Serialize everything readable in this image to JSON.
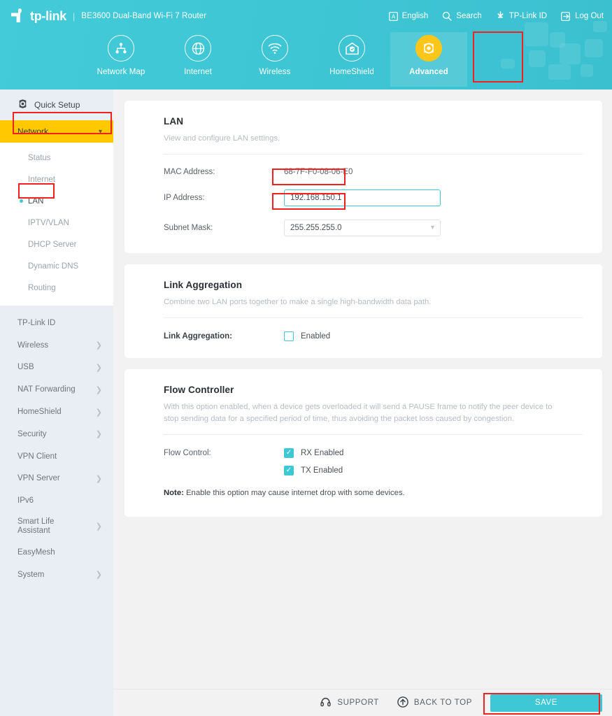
{
  "header": {
    "brand": "tp-link",
    "separator": "|",
    "model": "BE3600 Dual-Band Wi-Fi 7 Router",
    "utilities": [
      {
        "label": "English",
        "icon": "language-icon"
      },
      {
        "label": "Search",
        "icon": "search-icon"
      },
      {
        "label": "TP-Link ID",
        "icon": "tplink-id-icon"
      },
      {
        "label": "Log Out",
        "icon": "logout-icon"
      }
    ],
    "tabs": [
      {
        "label": "Network Map",
        "icon": "network-map-icon",
        "active": false
      },
      {
        "label": "Internet",
        "icon": "globe-icon",
        "active": false
      },
      {
        "label": "Wireless",
        "icon": "wifi-icon",
        "active": false
      },
      {
        "label": "HomeShield",
        "icon": "homeshield-icon",
        "active": false
      },
      {
        "label": "Advanced",
        "icon": "gear-icon",
        "active": true
      }
    ]
  },
  "sidebar": {
    "quick_setup": "Quick Setup",
    "network": {
      "label": "Network",
      "expanded": true,
      "items": [
        {
          "label": "Status",
          "selected": false
        },
        {
          "label": "Internet",
          "selected": false
        },
        {
          "label": "LAN",
          "selected": true
        },
        {
          "label": "IPTV/VLAN",
          "selected": false
        },
        {
          "label": "DHCP Server",
          "selected": false
        },
        {
          "label": "Dynamic DNS",
          "selected": false
        },
        {
          "label": "Routing",
          "selected": false
        }
      ]
    },
    "items": [
      {
        "label": "TP-Link ID",
        "has_arrow": false
      },
      {
        "label": "Wireless",
        "has_arrow": true
      },
      {
        "label": "USB",
        "has_arrow": true
      },
      {
        "label": "NAT Forwarding",
        "has_arrow": true
      },
      {
        "label": "HomeShield",
        "has_arrow": true
      },
      {
        "label": "Security",
        "has_arrow": true
      },
      {
        "label": "VPN Client",
        "has_arrow": false
      },
      {
        "label": "VPN Server",
        "has_arrow": true
      },
      {
        "label": "IPv6",
        "has_arrow": false
      },
      {
        "label": "Smart Life Assistant",
        "has_arrow": true
      },
      {
        "label": "EasyMesh",
        "has_arrow": false
      },
      {
        "label": "System",
        "has_arrow": true
      }
    ]
  },
  "lan_card": {
    "title": "LAN",
    "description": "View and configure LAN settings.",
    "mac_label": "MAC Address:",
    "mac_value": "68-7F-F0-08-06-E0",
    "ip_label": "IP Address:",
    "ip_value": "192.168.150.1",
    "subnet_label": "Subnet Mask:",
    "subnet_value": "255.255.255.0"
  },
  "link_aggregation_card": {
    "title": "Link Aggregation",
    "description": "Combine two LAN ports together to make a single high-bandwidth data path.",
    "field_label": "Link Aggregation:",
    "checkbox_label": "Enabled",
    "checked": false
  },
  "flow_controller_card": {
    "title": "Flow Controller",
    "description": "With this option enabled, when a device gets overloaded it will send a PAUSE frame to notify the peer device to stop sending data for a specified period of time, thus avoiding the packet loss caused by congestion.",
    "field_label": "Flow Control:",
    "rx_label": "RX Enabled",
    "rx_checked": true,
    "tx_label": "TX Enabled",
    "tx_checked": true,
    "note_prefix": "Note:",
    "note_text": " Enable this option may cause internet drop with some devices."
  },
  "footer": {
    "support": "SUPPORT",
    "back_to_top": "BACK TO TOP",
    "save": "SAVE"
  },
  "colors": {
    "brand_teal": "#3ec8d6",
    "header_teal": "#43cbd9",
    "accent_yellow": "#ffc800",
    "highlight_red": "#f32020",
    "sidebar_bg": "#e9eef5",
    "page_bg": "#f2f2f2"
  }
}
